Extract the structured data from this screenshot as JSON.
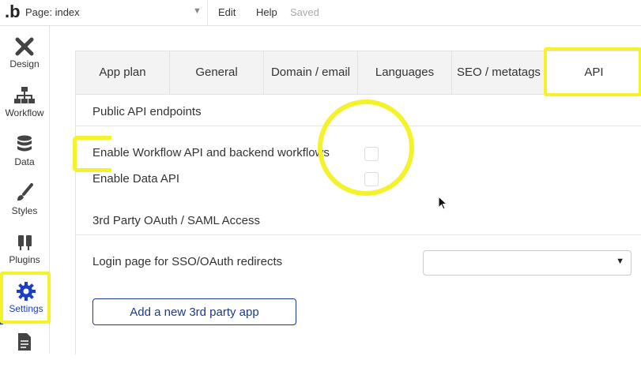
{
  "topbar": {
    "logo": ".b",
    "page_label": "Page: index",
    "menu": [
      "Edit",
      "Help"
    ],
    "status": "Saved"
  },
  "sidebar": {
    "items": [
      {
        "label": "Design",
        "icon": "design-icon"
      },
      {
        "label": "Workflow",
        "icon": "workflow-icon"
      },
      {
        "label": "Data",
        "icon": "database-icon"
      },
      {
        "label": "Styles",
        "icon": "brush-icon"
      },
      {
        "label": "Plugins",
        "icon": "plug-icon"
      },
      {
        "label": "Settings",
        "icon": "gear-icon",
        "active": true
      },
      {
        "label": "",
        "icon": "document-icon"
      }
    ]
  },
  "tabs": [
    "App plan",
    "General",
    "Domain / email",
    "Languages",
    "SEO / metatags",
    "API"
  ],
  "active_tab": "API",
  "api": {
    "public_title": "Public API endpoints",
    "workflow_api_label": "Enable Workflow API and backend workflows",
    "data_api_label": "Enable Data API",
    "oauth_title": "3rd Party OAuth / SAML Access",
    "login_page_label": "Login page for SSO/OAuth redirects",
    "login_page_value": "",
    "add_app_button": "Add a new 3rd party app"
  },
  "colors": {
    "accent": "#1b3ec4",
    "highlight": "#f4f22a",
    "tab_bg": "#f3f3f3"
  }
}
